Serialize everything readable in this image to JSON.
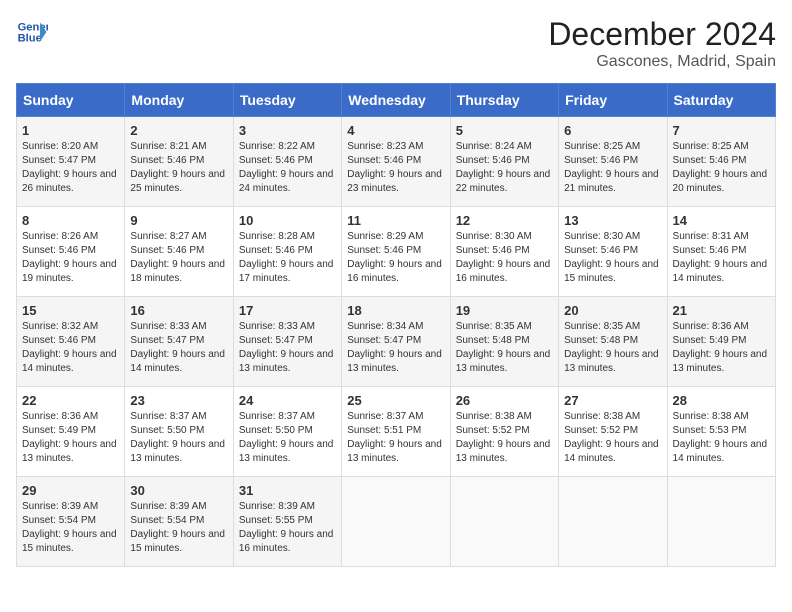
{
  "header": {
    "logo_line1": "General",
    "logo_line2": "Blue",
    "month": "December 2024",
    "location": "Gascones, Madrid, Spain"
  },
  "weekdays": [
    "Sunday",
    "Monday",
    "Tuesday",
    "Wednesday",
    "Thursday",
    "Friday",
    "Saturday"
  ],
  "weeks": [
    [
      {
        "day": "1",
        "sunrise": "8:20 AM",
        "sunset": "5:47 PM",
        "daylight": "9 hours and 26 minutes."
      },
      {
        "day": "2",
        "sunrise": "8:21 AM",
        "sunset": "5:46 PM",
        "daylight": "9 hours and 25 minutes."
      },
      {
        "day": "3",
        "sunrise": "8:22 AM",
        "sunset": "5:46 PM",
        "daylight": "9 hours and 24 minutes."
      },
      {
        "day": "4",
        "sunrise": "8:23 AM",
        "sunset": "5:46 PM",
        "daylight": "9 hours and 23 minutes."
      },
      {
        "day": "5",
        "sunrise": "8:24 AM",
        "sunset": "5:46 PM",
        "daylight": "9 hours and 22 minutes."
      },
      {
        "day": "6",
        "sunrise": "8:25 AM",
        "sunset": "5:46 PM",
        "daylight": "9 hours and 21 minutes."
      },
      {
        "day": "7",
        "sunrise": "8:25 AM",
        "sunset": "5:46 PM",
        "daylight": "9 hours and 20 minutes."
      }
    ],
    [
      {
        "day": "8",
        "sunrise": "8:26 AM",
        "sunset": "5:46 PM",
        "daylight": "9 hours and 19 minutes."
      },
      {
        "day": "9",
        "sunrise": "8:27 AM",
        "sunset": "5:46 PM",
        "daylight": "9 hours and 18 minutes."
      },
      {
        "day": "10",
        "sunrise": "8:28 AM",
        "sunset": "5:46 PM",
        "daylight": "9 hours and 17 minutes."
      },
      {
        "day": "11",
        "sunrise": "8:29 AM",
        "sunset": "5:46 PM",
        "daylight": "9 hours and 16 minutes."
      },
      {
        "day": "12",
        "sunrise": "8:30 AM",
        "sunset": "5:46 PM",
        "daylight": "9 hours and 16 minutes."
      },
      {
        "day": "13",
        "sunrise": "8:30 AM",
        "sunset": "5:46 PM",
        "daylight": "9 hours and 15 minutes."
      },
      {
        "day": "14",
        "sunrise": "8:31 AM",
        "sunset": "5:46 PM",
        "daylight": "9 hours and 14 minutes."
      }
    ],
    [
      {
        "day": "15",
        "sunrise": "8:32 AM",
        "sunset": "5:46 PM",
        "daylight": "9 hours and 14 minutes."
      },
      {
        "day": "16",
        "sunrise": "8:33 AM",
        "sunset": "5:47 PM",
        "daylight": "9 hours and 14 minutes."
      },
      {
        "day": "17",
        "sunrise": "8:33 AM",
        "sunset": "5:47 PM",
        "daylight": "9 hours and 13 minutes."
      },
      {
        "day": "18",
        "sunrise": "8:34 AM",
        "sunset": "5:47 PM",
        "daylight": "9 hours and 13 minutes."
      },
      {
        "day": "19",
        "sunrise": "8:35 AM",
        "sunset": "5:48 PM",
        "daylight": "9 hours and 13 minutes."
      },
      {
        "day": "20",
        "sunrise": "8:35 AM",
        "sunset": "5:48 PM",
        "daylight": "9 hours and 13 minutes."
      },
      {
        "day": "21",
        "sunrise": "8:36 AM",
        "sunset": "5:49 PM",
        "daylight": "9 hours and 13 minutes."
      }
    ],
    [
      {
        "day": "22",
        "sunrise": "8:36 AM",
        "sunset": "5:49 PM",
        "daylight": "9 hours and 13 minutes."
      },
      {
        "day": "23",
        "sunrise": "8:37 AM",
        "sunset": "5:50 PM",
        "daylight": "9 hours and 13 minutes."
      },
      {
        "day": "24",
        "sunrise": "8:37 AM",
        "sunset": "5:50 PM",
        "daylight": "9 hours and 13 minutes."
      },
      {
        "day": "25",
        "sunrise": "8:37 AM",
        "sunset": "5:51 PM",
        "daylight": "9 hours and 13 minutes."
      },
      {
        "day": "26",
        "sunrise": "8:38 AM",
        "sunset": "5:52 PM",
        "daylight": "9 hours and 13 minutes."
      },
      {
        "day": "27",
        "sunrise": "8:38 AM",
        "sunset": "5:52 PM",
        "daylight": "9 hours and 14 minutes."
      },
      {
        "day": "28",
        "sunrise": "8:38 AM",
        "sunset": "5:53 PM",
        "daylight": "9 hours and 14 minutes."
      }
    ],
    [
      {
        "day": "29",
        "sunrise": "8:39 AM",
        "sunset": "5:54 PM",
        "daylight": "9 hours and 15 minutes."
      },
      {
        "day": "30",
        "sunrise": "8:39 AM",
        "sunset": "5:54 PM",
        "daylight": "9 hours and 15 minutes."
      },
      {
        "day": "31",
        "sunrise": "8:39 AM",
        "sunset": "5:55 PM",
        "daylight": "9 hours and 16 minutes."
      },
      null,
      null,
      null,
      null
    ]
  ]
}
